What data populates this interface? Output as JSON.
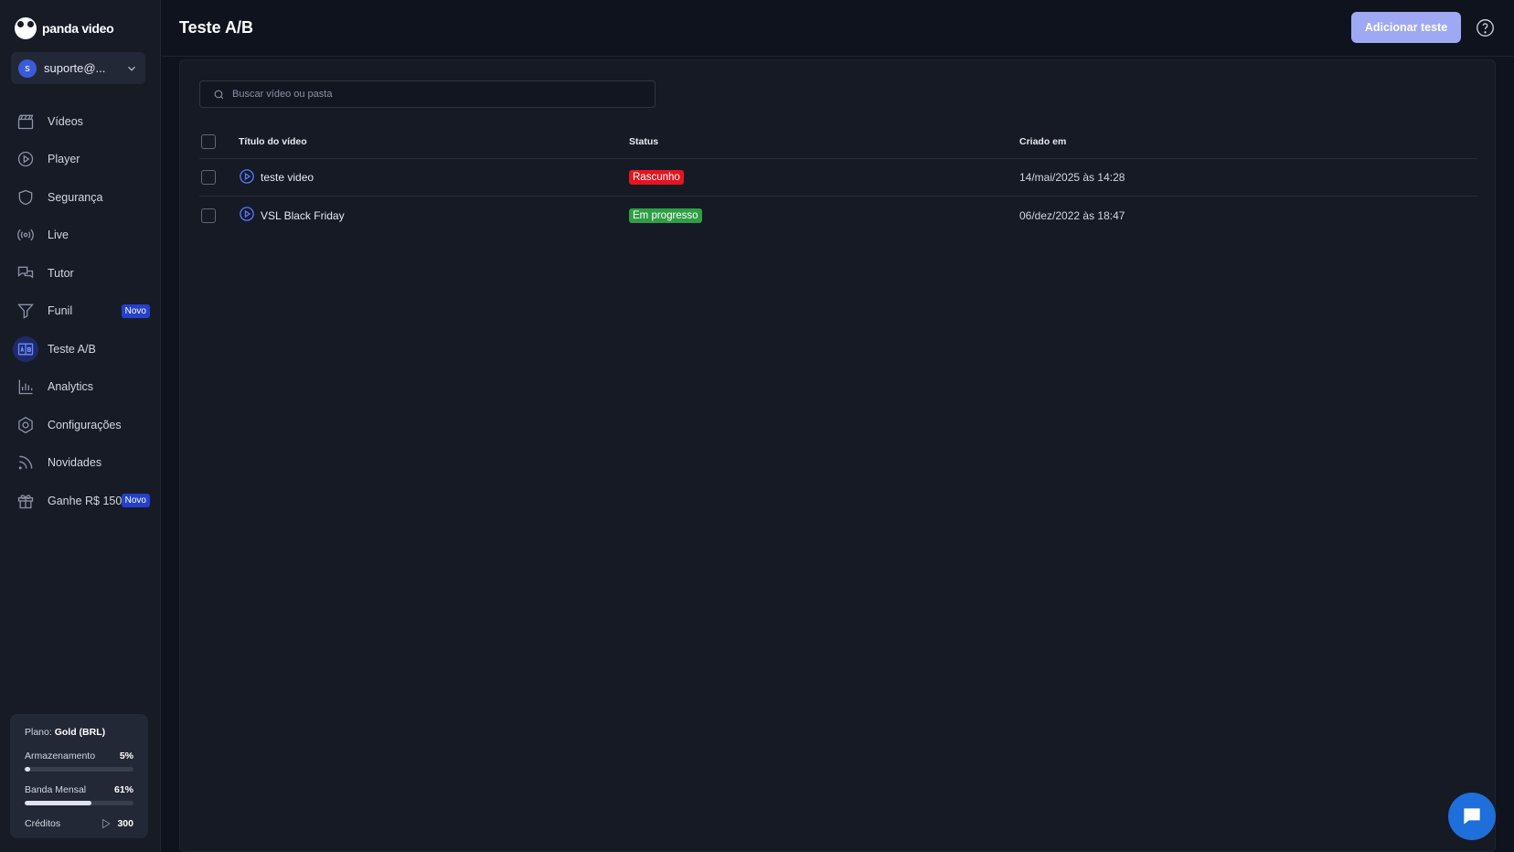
{
  "brand": {
    "name": "panda video"
  },
  "account": {
    "initial": "s",
    "label": "suporte@..."
  },
  "sidebar": {
    "items": [
      {
        "label": "Vídeos",
        "icon": "clapperboard-icon"
      },
      {
        "label": "Player",
        "icon": "play-circle-icon"
      },
      {
        "label": "Segurança",
        "icon": "shield-icon"
      },
      {
        "label": "Live",
        "icon": "broadcast-icon"
      },
      {
        "label": "Tutor",
        "icon": "chat-bubbles-icon"
      },
      {
        "label": "Funil",
        "icon": "funnel-icon",
        "badge": "Novo"
      },
      {
        "label": "Teste A/B",
        "icon": "ab-test-icon",
        "active": true
      },
      {
        "label": "Analytics",
        "icon": "bar-chart-icon"
      },
      {
        "label": "Configurações",
        "icon": "gear-icon"
      },
      {
        "label": "Novidades",
        "icon": "rss-icon"
      },
      {
        "label": "Ganhe R$ 150",
        "icon": "gift-icon",
        "badge": "Novo"
      }
    ]
  },
  "plan": {
    "prefix": "Plano:",
    "name": "Gold (BRL)",
    "storage_label": "Armazenamento",
    "storage_value": "5%",
    "storage_fraction": 0.05,
    "bandwidth_label": "Banda Mensal",
    "bandwidth_value": "61%",
    "bandwidth_fraction": 0.61,
    "credits_label": "Créditos",
    "credits_value": "300"
  },
  "header": {
    "title": "Teste A/B",
    "add_button": "Adicionar teste"
  },
  "search": {
    "placeholder": "Buscar vídeo ou pasta"
  },
  "table": {
    "columns": {
      "title": "Título do vídeo",
      "status": "Status",
      "created": "Criado em"
    },
    "rows": [
      {
        "title": "teste video",
        "status": "Rascunho",
        "status_color": "#e5141f",
        "created": "14/mai/2025 às 14:28"
      },
      {
        "title": "VSL Black Friday",
        "status": "Em progresso",
        "status_color": "#2f9e44",
        "created": "06/dez/2022 às 18:47"
      }
    ]
  },
  "colors": {
    "accent": "#9fa9f3",
    "active_nav": "#1d2b6b",
    "badge": "#2540c9",
    "chat": "#1e6fd9"
  }
}
